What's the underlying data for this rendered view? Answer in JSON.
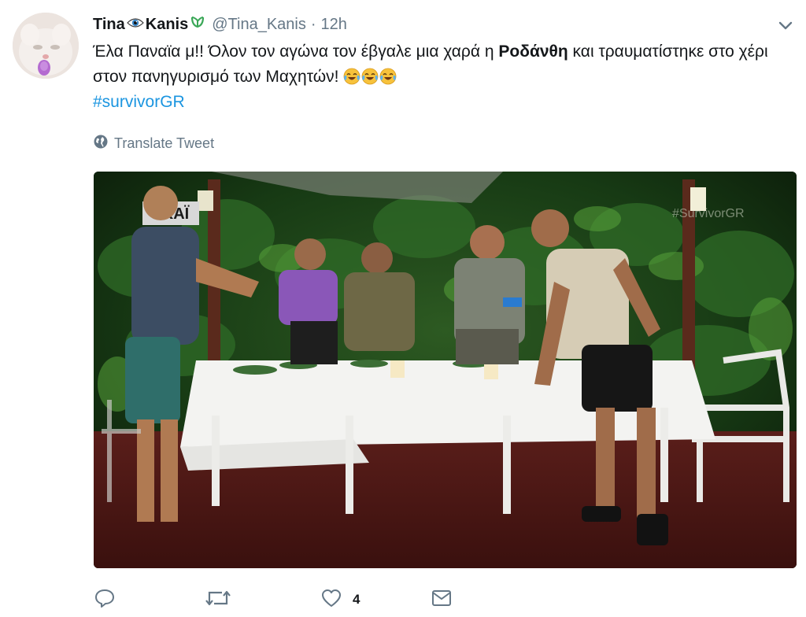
{
  "tweet": {
    "author_first": "Tina",
    "author_last": "Kanis",
    "handle": "@Tina_Kanis",
    "dot": "·",
    "time": "12h",
    "text_part1": "Έλα Παναϊα μ!! Όλον τον αγώνα τον έβγαλε μια χαρά η ",
    "text_bold": "Ροδάνθη",
    "text_part2": " και τραυματίστηκε στο χέρι στον πανηγυρισμό των Μαχητών! ",
    "hashtag": "#survivorGR",
    "translate_label": "Translate Tweet",
    "like_count": "4"
  },
  "media": {
    "channel_logo": "ΣΚΑΪ",
    "watermark": "#SurvivorGR"
  },
  "icons": {
    "reply": "reply-icon",
    "retweet": "retweet-icon",
    "like": "heart-icon",
    "dm": "envelope-icon",
    "globe": "globe-icon",
    "caret": "chevron-down-icon",
    "eye": "eye-emoji-icon",
    "verified": "seedling-icon",
    "laugh": "tears-of-joy-emoji-icon"
  },
  "colors": {
    "text": "#14171a",
    "muted": "#657786",
    "link": "#1b95e0"
  }
}
